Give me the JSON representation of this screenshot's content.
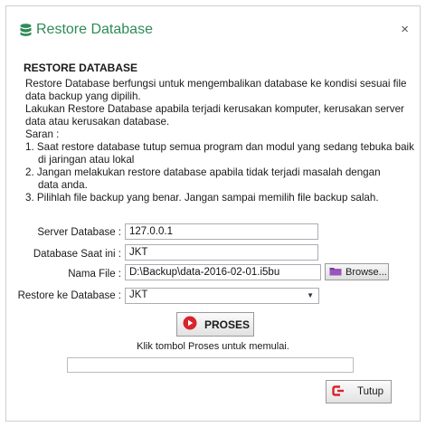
{
  "window": {
    "title": "Restore Database",
    "close_glyph": "×",
    "accent": "#2e8b57"
  },
  "content": {
    "heading": "RESTORE DATABASE",
    "lines": [
      "Restore Database berfungsi untuk mengembalikan database ke kondisi sesuai file",
      "data backup yang dipilih.",
      "Lakukan Restore Database apabila terjadi kerusakan komputer, kerusakan server",
      "data atau kerusakan database.",
      "Saran :",
      "1. Saat restore database tutup semua program dan modul yang sedang tebuka baik",
      "di jaringan atau lokal",
      "2. Jangan melakukan restore database apabila tidak terjadi masalah dengan",
      "data anda.",
      "3. Pilihlah file backup yang benar. Jangan sampai memilih file backup salah."
    ]
  },
  "form": {
    "server_label": "Server Database :",
    "server_value": "127.0.0.1",
    "db_label": "Database Saat ini :",
    "db_value": "JKT",
    "file_label": "Nama File :",
    "file_value": "D:\\Backup\\data-2016-02-01.i5bu",
    "browse_label": "Browse...",
    "restore_label": "Restore ke Database :",
    "restore_value": "JKT"
  },
  "actions": {
    "proses_label": "PROSES",
    "hint": "Klik tombol Proses untuk memulai.",
    "progress_percent": 0,
    "tutup_label": "Tutup"
  },
  "icons": {
    "title": "database-icon",
    "browse": "folder-icon",
    "proses": "record-icon",
    "tutup": "exit-icon"
  }
}
